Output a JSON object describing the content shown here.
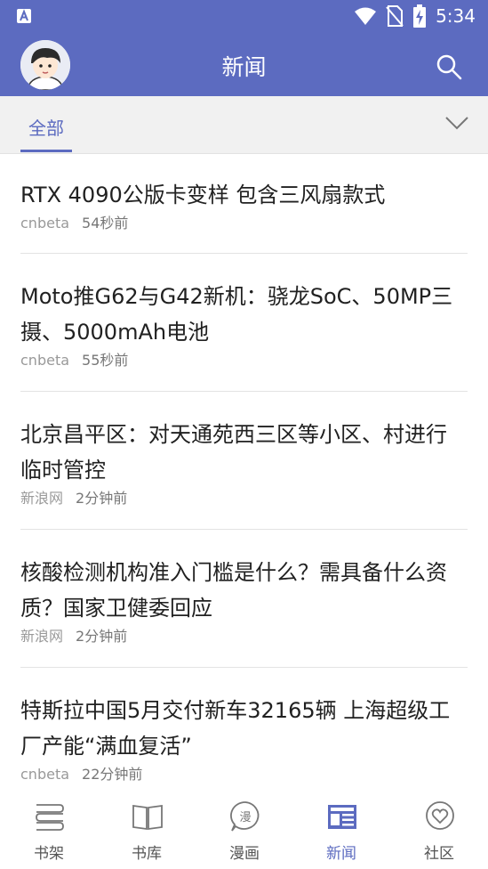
{
  "status_bar": {
    "time": "5:34"
  },
  "header": {
    "title": "新闻"
  },
  "tabs": {
    "active": "全部"
  },
  "news": [
    {
      "title": "RTX 4090公版卡变样 包含三风扇款式",
      "source": "cnbeta",
      "time": "54秒前"
    },
    {
      "title": "Moto推G62与G42新机：骁龙SoC、50MP三摄、5000mAh电池",
      "source": "cnbeta",
      "time": "55秒前"
    },
    {
      "title": "北京昌平区：对天通苑西三区等小区、村进行临时管控",
      "source": "新浪网",
      "time": "2分钟前"
    },
    {
      "title": "核酸检测机构准入门槛是什么？需具备什么资质？国家卫健委回应",
      "source": "新浪网",
      "time": "2分钟前"
    },
    {
      "title": "特斯拉中国5月交付新车32165辆 上海超级工厂产能“满血复活”",
      "source": "cnbeta",
      "time": "22分钟前"
    }
  ],
  "bottom_nav": {
    "items": [
      {
        "label": "书架",
        "icon": "bookshelf-icon"
      },
      {
        "label": "书库",
        "icon": "book-icon"
      },
      {
        "label": "漫画",
        "icon": "comic-icon"
      },
      {
        "label": "新闻",
        "icon": "news-icon"
      },
      {
        "label": "社区",
        "icon": "community-icon"
      }
    ],
    "active_index": 3
  },
  "colors": {
    "primary": "#5c6bc0",
    "tab_bg": "#f1f1f1",
    "text": "#212121",
    "meta": "#999999"
  }
}
